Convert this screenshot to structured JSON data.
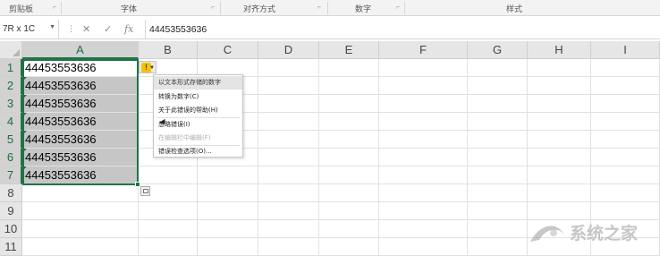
{
  "ribbon": {
    "groups": [
      "剪贴板",
      "字体",
      "对齐方式",
      "数字",
      "样式"
    ]
  },
  "formula_bar": {
    "name_box": "7R x 1C",
    "cancel_icon": "✕",
    "enter_icon": "✓",
    "fx_label": "fx",
    "value": "44453553636"
  },
  "grid": {
    "columns": [
      "A",
      "B",
      "C",
      "D",
      "E",
      "F",
      "G",
      "H",
      "I"
    ],
    "rows": [
      "1",
      "2",
      "3",
      "4",
      "5",
      "6",
      "7",
      "8",
      "9",
      "10",
      "11"
    ],
    "column_a_values": [
      "44453553636",
      "44453553636",
      "44453553636",
      "44453553636",
      "44453553636",
      "44453553636",
      "44453553636"
    ]
  },
  "error_menu": {
    "icon": "warning-icon",
    "items": [
      {
        "label": "以文本形式存储的数字",
        "state": "header"
      },
      {
        "label": "转换为数字(C)",
        "state": "enabled"
      },
      {
        "label": "关于此错误的帮助(H)",
        "state": "enabled"
      },
      {
        "label": "忽略错误(I)",
        "state": "enabled"
      },
      {
        "label": "在编辑栏中编辑(F)",
        "state": "disabled"
      },
      {
        "label": "错误检查选项(O)...",
        "state": "enabled"
      }
    ]
  },
  "watermark": {
    "text": "系统之家"
  },
  "colors": {
    "accent": "#217346",
    "selection_fill": "#c6c6c6",
    "warning": "#f5c400"
  }
}
